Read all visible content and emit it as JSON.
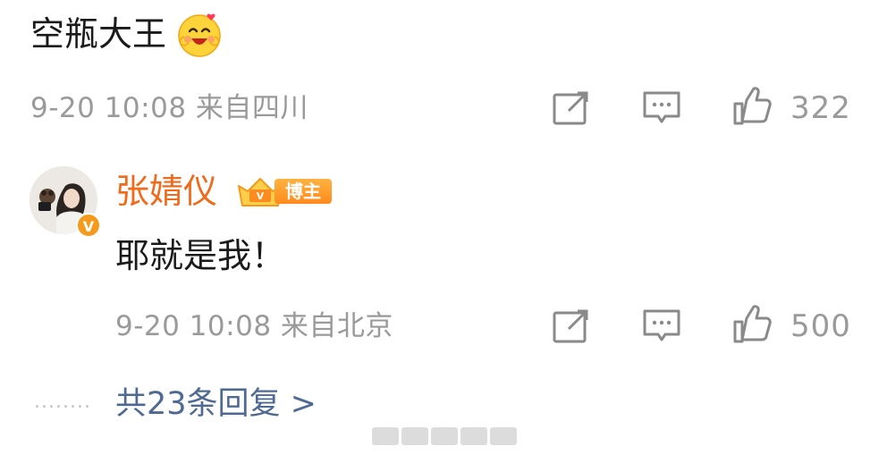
{
  "comment": {
    "text": "空瓶大王",
    "emoji": "laughing-love-emoji",
    "meta": {
      "time": "9-20 10:08",
      "location": "来自四川"
    },
    "like_count": "322"
  },
  "reply": {
    "username": "张婧仪",
    "badge_label": "博主",
    "verified_mark": "V",
    "text": "耶就是我！",
    "meta": {
      "time": "9-20 10:08",
      "location": "来自北京"
    },
    "like_count": "500"
  },
  "more_replies": {
    "label": "共23条回复 >",
    "dots": "........"
  },
  "icons": {
    "share": "share-icon",
    "comment": "comment-icon",
    "like": "like-icon"
  },
  "colors": {
    "username": "#f06a1b",
    "link": "#4f6a92",
    "meta": "#9a9a9a",
    "badge": "#ff9a2a"
  }
}
